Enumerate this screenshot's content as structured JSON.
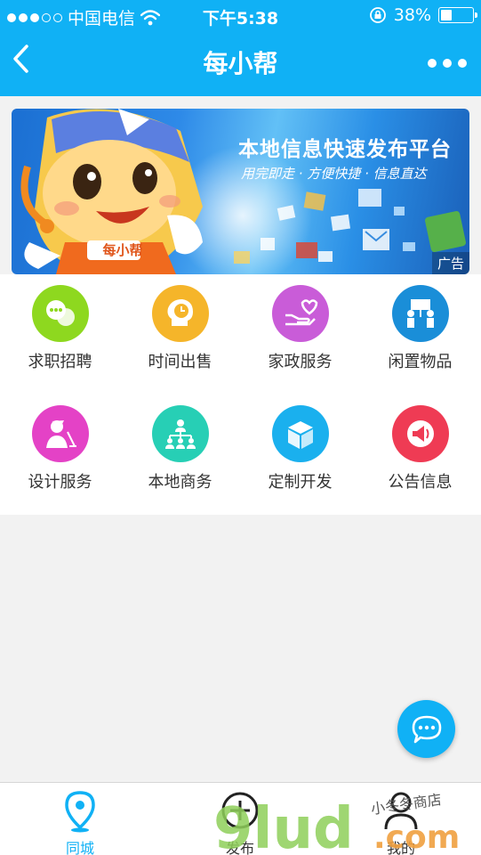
{
  "status_bar": {
    "carrier": "中国电信",
    "time": "下午5:38",
    "battery": "38%",
    "signal_bars": 3,
    "battery_level": 0.38
  },
  "nav": {
    "title": "每小帮",
    "back_icon": "chevron-left-icon",
    "more_icon": "more-horizontal-icon"
  },
  "banner": {
    "title": "本地信息快速发布平台",
    "subtitle": "用完即走 · 方便快捷 · 信息直达",
    "ad_tag": "广告",
    "mascot_badge": "每小帮"
  },
  "categories": [
    {
      "label": "求职招聘",
      "icon": "chat-bubbles-icon",
      "color": "#8ed81f"
    },
    {
      "label": "时间出售",
      "icon": "clock-head-icon",
      "color": "#f5b52a"
    },
    {
      "label": "家政服务",
      "icon": "hand-heart-icon",
      "color": "#c95cd8"
    },
    {
      "label": "闲置物品",
      "icon": "people-board-icon",
      "color": "#1a8ed8"
    },
    {
      "label": "设计服务",
      "icon": "designer-icon",
      "color": "#e442c6"
    },
    {
      "label": "本地商务",
      "icon": "org-chart-icon",
      "color": "#27cfb5"
    },
    {
      "label": "定制开发",
      "icon": "package-box-icon",
      "color": "#1ab0ee"
    },
    {
      "label": "公告信息",
      "icon": "megaphone-icon",
      "color": "#ef3b54"
    }
  ],
  "fab": {
    "icon": "chat-bubble-icon"
  },
  "tabs": [
    {
      "label": "同城",
      "icon": "location-pin-icon",
      "active": true
    },
    {
      "label": "发布",
      "icon": "plus-circle-icon",
      "active": false
    },
    {
      "label": "我的",
      "icon": "user-icon",
      "active": false
    }
  ],
  "watermark": {
    "main": "9lud",
    "domain": ".com",
    "small": "小冬冬商店"
  },
  "colors": {
    "primary": "#10b1f5",
    "text": "#333333",
    "background": "#f2f2f2"
  }
}
